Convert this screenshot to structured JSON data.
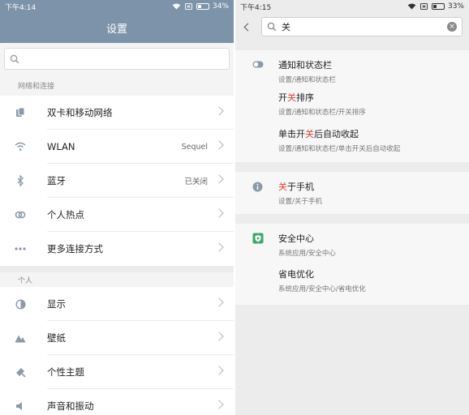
{
  "left": {
    "status": {
      "time": "下午4:14",
      "battery": "34%",
      "battery_level": 0.34
    },
    "title": "设置",
    "search": {
      "placeholder": ""
    },
    "sections": [
      {
        "header": "网络和连接",
        "items": [
          {
            "icon": "sim-cards-icon",
            "label": "双卡和移动网络",
            "value": ""
          },
          {
            "icon": "wifi-icon",
            "label": "WLAN",
            "value": "Sequel"
          },
          {
            "icon": "bluetooth-icon",
            "label": "蓝牙",
            "value": "已关闭"
          },
          {
            "icon": "hotspot-icon",
            "label": "个人热点",
            "value": ""
          },
          {
            "icon": "more-dots-icon",
            "label": "更多连接方式",
            "value": ""
          }
        ]
      },
      {
        "header": "个人",
        "items": [
          {
            "icon": "display-icon",
            "label": "显示",
            "value": ""
          },
          {
            "icon": "wallpaper-icon",
            "label": "壁纸",
            "value": ""
          },
          {
            "icon": "theme-brush-icon",
            "label": "个性主题",
            "value": ""
          },
          {
            "icon": "speaker-icon",
            "label": "声音和振动",
            "value": ""
          }
        ]
      }
    ]
  },
  "right": {
    "status": {
      "time": "下午4:15",
      "battery": "33%",
      "battery_level": 0.33
    },
    "search": {
      "query": "关"
    },
    "groups": [
      [
        {
          "icon": "toggle-icon",
          "title_pre": "通知和状态栏",
          "title_hl": "",
          "title_post": "",
          "subtitle": "设置/通知和状态栏"
        },
        {
          "icon": "",
          "title_pre": "开",
          "title_hl": "关",
          "title_post": "排序",
          "subtitle": "设置/通知和状态栏/开关排序"
        },
        {
          "icon": "",
          "title_pre": "单击开",
          "title_hl": "关",
          "title_post": "后自动收起",
          "subtitle": "设置/通知和状态栏/单击开关后自动收起"
        }
      ],
      [
        {
          "icon": "info-icon",
          "title_pre": "",
          "title_hl": "关",
          "title_post": "于手机",
          "subtitle": "设置/关于手机"
        }
      ],
      [
        {
          "icon": "security-shield-icon",
          "title_pre": "安全中心",
          "title_hl": "",
          "title_post": "",
          "subtitle": "系统应用/安全中心"
        },
        {
          "icon": "",
          "title_pre": "省电优化",
          "title_hl": "",
          "title_post": "",
          "subtitle": "系统应用/安全中心/省电优化"
        }
      ]
    ],
    "colors": {
      "highlight": "#e23b2e",
      "accent_green": "#3fa76b",
      "info_grey": "#8c9aa8"
    }
  }
}
